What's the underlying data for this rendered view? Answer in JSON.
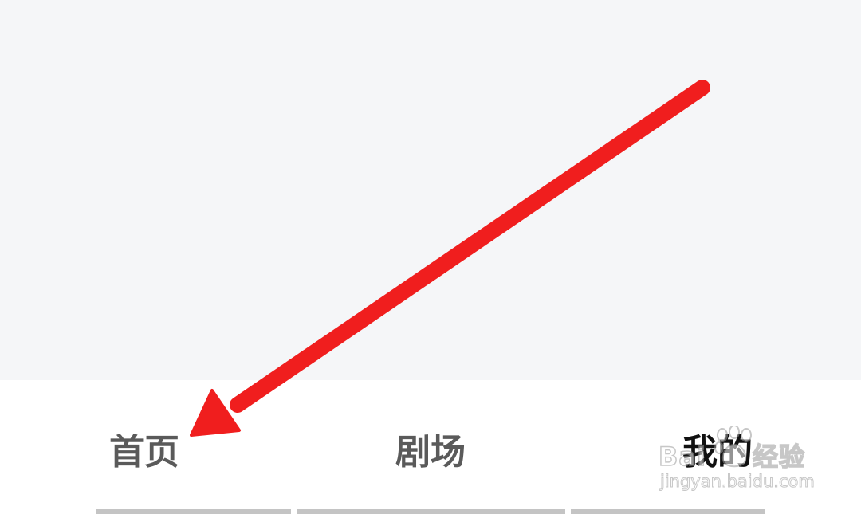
{
  "tabs": {
    "home": "首页",
    "theater": "剧场",
    "mine": "我的"
  },
  "watermark": {
    "brand_left": "Bai",
    "brand_right": "经验",
    "url": "jingyan.baidu.com"
  },
  "colors": {
    "content_background": "#f5f6f8",
    "tabbar_background": "#ffffff",
    "tab_text": "#5a5a5a",
    "tab_text_active": "#111111",
    "annotation_arrow": "#f01e1e",
    "indicator_bar": "#c4c4c4"
  },
  "annotation": {
    "icon": "red-arrow-pointing-to-home-tab"
  }
}
